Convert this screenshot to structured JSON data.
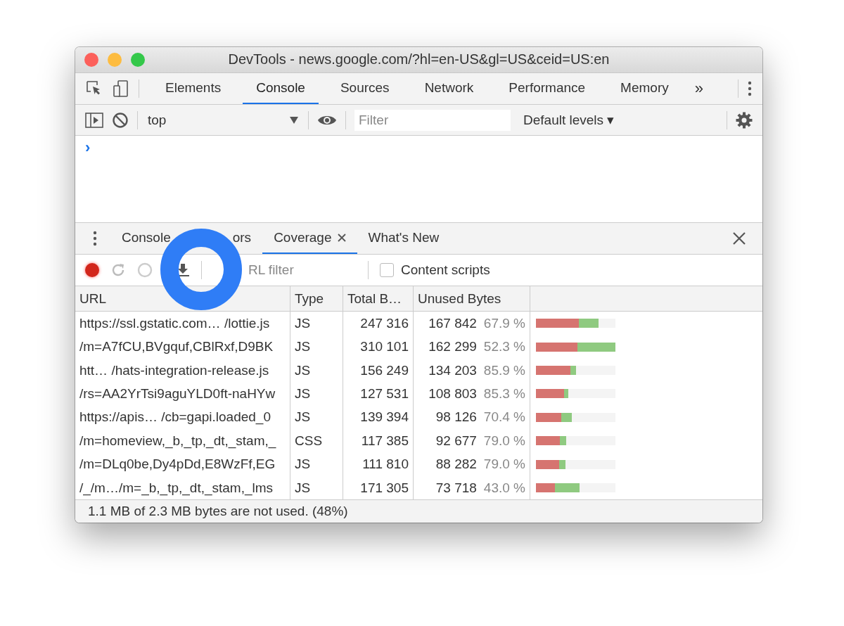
{
  "window": {
    "title": "DevTools - news.google.com/?hl=en-US&gl=US&ceid=US:en"
  },
  "main_tabs": [
    {
      "label": "Elements",
      "selected": false
    },
    {
      "label": "Console",
      "selected": true
    },
    {
      "label": "Sources",
      "selected": false
    },
    {
      "label": "Network",
      "selected": false
    },
    {
      "label": "Performance",
      "selected": false
    },
    {
      "label": "Memory",
      "selected": false
    }
  ],
  "more_tabs": "»",
  "console_toolbar": {
    "context": "top",
    "filter_placeholder": "Filter",
    "levels": "Default levels ▾"
  },
  "console": {
    "prompt": "›"
  },
  "drawer_tabs": [
    {
      "label": "Console",
      "selected": false,
      "closable": false
    },
    {
      "label": "ors",
      "selected": false,
      "closable": false
    },
    {
      "label": "Coverage",
      "selected": true,
      "closable": true
    },
    {
      "label": "What's New",
      "selected": false,
      "closable": false
    }
  ],
  "coverage_toolbar": {
    "recording": true,
    "url_filter_placeholder": "RL filter",
    "content_scripts": {
      "label": "Content scripts",
      "checked": false
    }
  },
  "table": {
    "columns": [
      "URL",
      "Type",
      "Total B…",
      "Unused Bytes"
    ],
    "rows": [
      {
        "url": "https://ssl.gstatic.com… /lottie.js",
        "type": "JS",
        "total": "247 316",
        "unused": "167 842",
        "percent": "67.9 %",
        "bar": {
          "level": 0.79,
          "unused_share": {
            "level": 0.679
          }
        }
      },
      {
        "url": "/m=A7fCU,BVgquf,CBlRxf,D9BK",
        "type": "JS",
        "total": "310 101",
        "unused": "162 299",
        "percent": "52.3 %",
        "bar": {
          "level": 1.0,
          "unused_share": {
            "level": 0.523
          }
        }
      },
      {
        "url": "htt…  /hats-integration-release.js",
        "type": "JS",
        "total": "156 249",
        "unused": "134 203",
        "percent": "85.9 %",
        "bar": {
          "level": 0.5,
          "unused_share": {
            "level": 0.859
          }
        }
      },
      {
        "url": "/rs=AA2YrTsi9aguYLD0ft-naHYw",
        "type": "JS",
        "total": "127 531",
        "unused": "108 803",
        "percent": "85.3 %",
        "bar": {
          "level": 0.41,
          "unused_share": {
            "level": 0.853
          }
        }
      },
      {
        "url": "https://apis… /cb=gapi.loaded_0",
        "type": "JS",
        "total": "139 394",
        "unused": "98 126",
        "percent": "70.4 %",
        "bar": {
          "level": 0.45,
          "unused_share": {
            "level": 0.704
          }
        }
      },
      {
        "url": "/m=homeview,_b,_tp,_dt,_stam,_",
        "type": "CSS",
        "total": "117 385",
        "unused": "92 677",
        "percent": "79.0 %",
        "bar": {
          "level": 0.38,
          "unused_share": {
            "level": 0.79
          }
        }
      },
      {
        "url": "/m=DLq0be,Dy4pDd,E8WzFf,EG",
        "type": "JS",
        "total": "111 810",
        "unused": "88 282",
        "percent": "79.0 %",
        "bar": {
          "level": 0.37,
          "unused_share": {
            "level": 0.79
          }
        }
      },
      {
        "url": "/_/m…/m=_b,_tp,_dt,_stam,_lms",
        "type": "JS",
        "total": "171 305",
        "unused": "73 718",
        "percent": "43.0 %",
        "bar": {
          "level": 0.55,
          "unused_share": {
            "level": 0.43
          }
        }
      }
    ]
  },
  "status_bar": "1.1 MB of 2.3 MB bytes are not used. (48%)"
}
